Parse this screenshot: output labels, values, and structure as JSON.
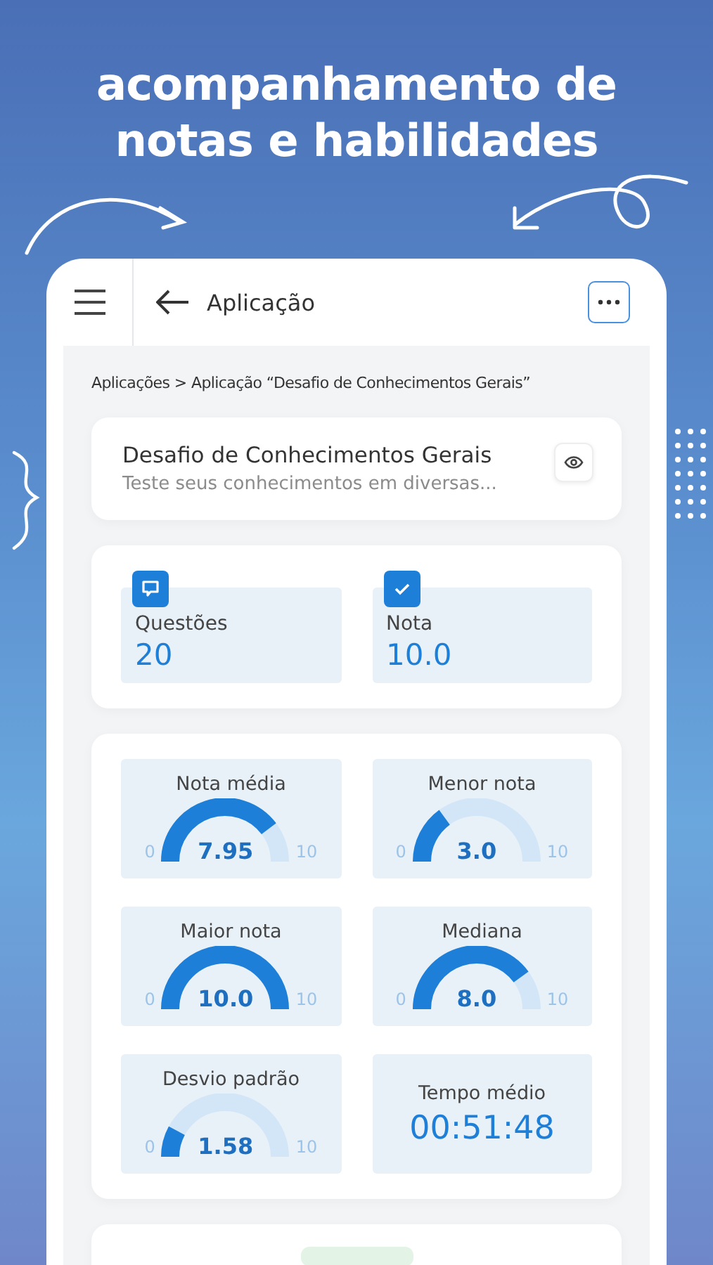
{
  "headline": "acompanhamento de notas e habilidades",
  "header": {
    "title": "Aplicação"
  },
  "breadcrumb": "Aplicações > Aplicação “Desafio de Conhecimentos Gerais”",
  "application": {
    "title": "Desafio de Conhecimentos Gerais",
    "description": "Teste seus conhecimentos em diversas..."
  },
  "stats": [
    {
      "kind": "questions",
      "label": "Questões",
      "value": "20"
    },
    {
      "kind": "grade",
      "label": "Nota",
      "value": "10.0"
    }
  ],
  "metrics": [
    {
      "kind": "gauge",
      "label": "Nota média",
      "value": "7.95",
      "min": "0",
      "max": "10"
    },
    {
      "kind": "gauge",
      "label": "Menor nota",
      "value": "3.0",
      "min": "0",
      "max": "10"
    },
    {
      "kind": "gauge",
      "label": "Maior nota",
      "value": "10.0",
      "min": "0",
      "max": "10"
    },
    {
      "kind": "gauge",
      "label": "Mediana",
      "value": "8.0",
      "min": "0",
      "max": "10"
    },
    {
      "kind": "gauge",
      "label": "Desvio padrão",
      "value": "1.58",
      "min": "0",
      "max": "10"
    },
    {
      "kind": "time",
      "label": "Tempo médio",
      "value": "00:51:48"
    }
  ]
}
